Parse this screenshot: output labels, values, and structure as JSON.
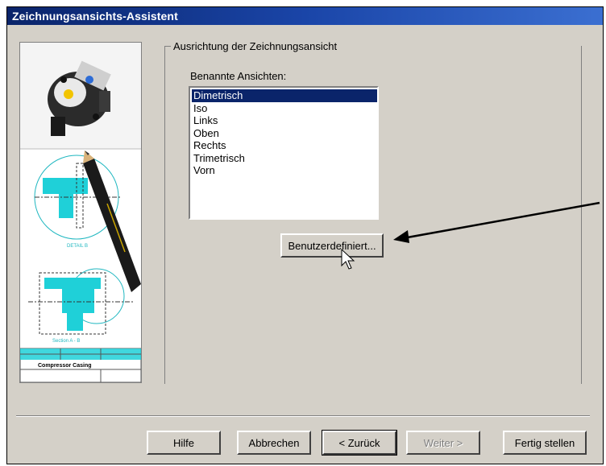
{
  "window": {
    "title": "Zeichnungsansichts-Assistent"
  },
  "side_image": {
    "drawing_label_1": "DETAIL B",
    "drawing_label_2": "Section A - B",
    "title_block_text": "Compressor Casing"
  },
  "group": {
    "label": "Ausrichtung der Zeichnungsansicht",
    "list_label": "Benannte Ansichten:",
    "views": [
      "Dimetrisch",
      "Iso",
      "Links",
      "Oben",
      "Rechts",
      "Trimetrisch",
      "Vorn"
    ],
    "selected_view": "Dimetrisch",
    "custom_button": "Benutzerdefiniert..."
  },
  "footer": {
    "help": "Hilfe",
    "cancel": "Abbrechen",
    "back": "< Zurück",
    "next": "Weiter >",
    "finish": "Fertig stellen"
  },
  "colors": {
    "title_gradient_start": "#0a246a",
    "title_gradient_end": "#3b6fd1",
    "selection": "#0a246a",
    "drawing_cyan": "#1fd0d8"
  }
}
